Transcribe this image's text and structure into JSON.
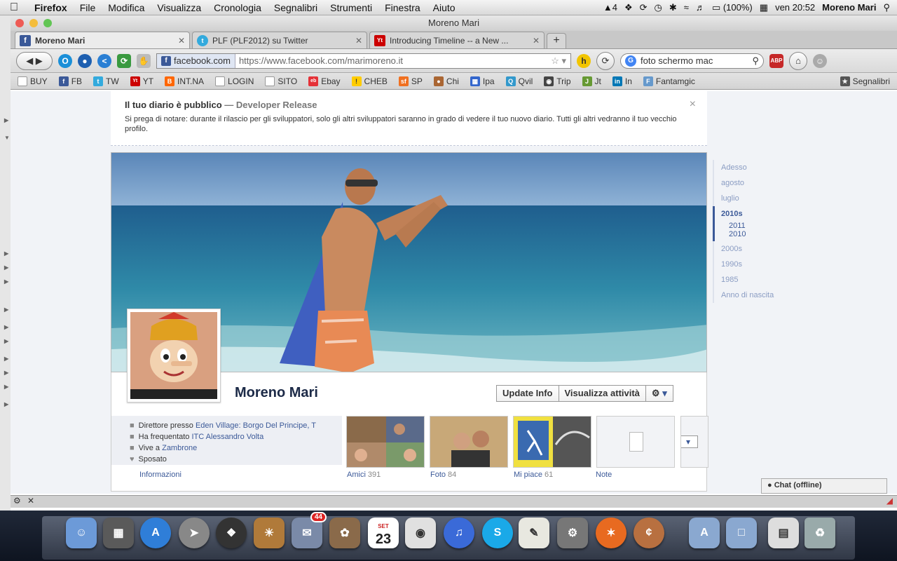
{
  "menubar": {
    "app": "Firefox",
    "items": [
      "File",
      "Modifica",
      "Visualizza",
      "Cronologia",
      "Segnalibri",
      "Strumenti",
      "Finestra",
      "Aiuto"
    ],
    "battery": "(100%)",
    "clock": "ven 20:52",
    "user": "Moreno Mari",
    "notify_count": "4"
  },
  "window": {
    "title": "Moreno Mari"
  },
  "tabs": [
    {
      "label": "Moreno Mari",
      "active": true
    },
    {
      "label": "PLF (PLF2012) su Twitter",
      "active": false
    },
    {
      "label": "Introducing Timeline -- a New ...",
      "active": false
    }
  ],
  "newtab": "+",
  "navbar": {
    "site": "facebook.com",
    "url": "https://www.facebook.com/marimoreno.it",
    "search_value": "foto schermo mac"
  },
  "bookmarks": [
    {
      "label": "BUY",
      "color": "#ffffff"
    },
    {
      "label": "FB",
      "color": "#3b5998"
    },
    {
      "label": "TW",
      "color": "#33aadd"
    },
    {
      "label": "YT",
      "color": "#cc0000"
    },
    {
      "label": "INT.NA",
      "color": "#ff6600"
    },
    {
      "label": "LOGIN",
      "color": "#ffffff"
    },
    {
      "label": "SITO",
      "color": "#ffffff"
    },
    {
      "label": "Ebay",
      "color": "#e53238"
    },
    {
      "label": "CHEB",
      "color": "#ffcc00"
    },
    {
      "label": "SP",
      "color": "#f07020"
    },
    {
      "label": "Chi",
      "color": "#aa6633"
    },
    {
      "label": "Ipa",
      "color": "#3366cc"
    },
    {
      "label": "Qvil",
      "color": "#3399cc"
    },
    {
      "label": "Trip",
      "color": "#444444"
    },
    {
      "label": "Jt",
      "color": "#669933"
    },
    {
      "label": "In",
      "color": "#0077b5"
    },
    {
      "label": "Fantamgic",
      "color": "#6699cc"
    }
  ],
  "bookmarks_menu": "Segnalibri",
  "notice": {
    "title": "Il tuo diario è pubblico",
    "subtitle": "— Developer Release",
    "body": "Si prega di notare: durante il rilascio per gli sviluppatori, solo gli altri sviluppatori saranno in grado di vedere il tuo nuovo diario. Tutti gli altri vedranno il tuo vecchio profilo.",
    "close": "×"
  },
  "profile": {
    "name": "Moreno Mari",
    "update_info": "Update Info",
    "activity": "Visualizza attività",
    "facts": [
      {
        "prefix": "Direttore presso ",
        "link": "Eden Village: Borgo Del Principe, T"
      },
      {
        "prefix": "Ha frequentato ",
        "link": "ITC Alessandro Volta"
      },
      {
        "prefix": "Vive a ",
        "link": "Zambrone"
      },
      {
        "prefix": "Sposato",
        "link": ""
      }
    ],
    "info_link": "Informazioni",
    "tiles": [
      {
        "label": "Amici",
        "count": "391"
      },
      {
        "label": "Foto",
        "count": "84"
      },
      {
        "label": "Mi piace",
        "count": "61"
      },
      {
        "label": "Note",
        "count": ""
      }
    ]
  },
  "timeline": {
    "years": [
      "Adesso",
      "agosto",
      "luglio",
      "2010s",
      "2011",
      "2010",
      "2000s",
      "1990s",
      "1985",
      "Anno di nascita"
    ]
  },
  "chat": "Chat (offline)",
  "dock": {
    "calendar_day": "23",
    "calendar_month": "SET",
    "mail_badge": "44"
  }
}
